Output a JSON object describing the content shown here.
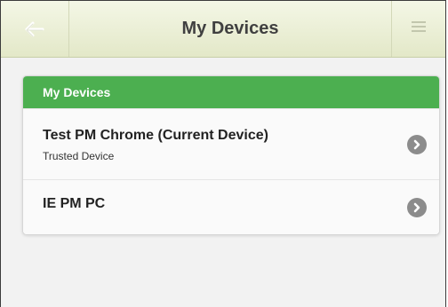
{
  "header": {
    "title": "My Devices",
    "back_icon": "arrow-left-icon",
    "menu_icon": "hamburger-menu-icon"
  },
  "card": {
    "title": "My Devices",
    "accent_color": "#4caf50",
    "devices": [
      {
        "name": "Test PM Chrome (Current Device)",
        "subtitle": "Trusted Device"
      },
      {
        "name": "IE PM PC",
        "subtitle": ""
      }
    ]
  }
}
